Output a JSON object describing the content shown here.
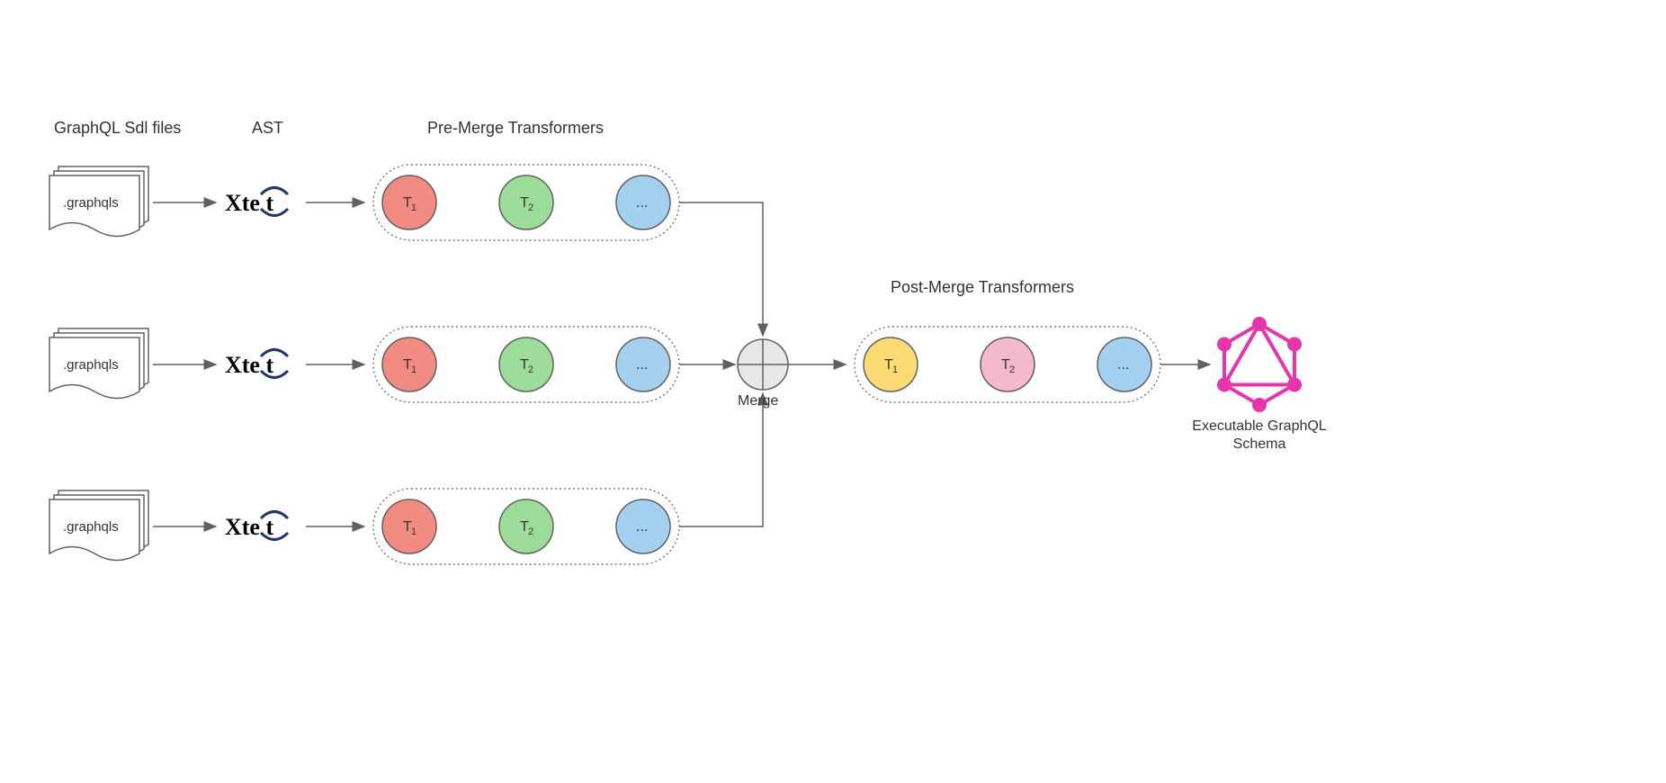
{
  "headers": {
    "sdl": "GraphQL Sdl files",
    "ast": "AST",
    "pre": "Pre-Merge Transformers",
    "post": "Post-Merge Transformers"
  },
  "file_label": ".graphqls",
  "xtext": "Xte  t",
  "transformers": {
    "t1": "T",
    "t1_sub": "1",
    "t2": "T",
    "t2_sub": "2",
    "t3": "..."
  },
  "merge_label": "Merge",
  "output_label_1": "Executable GraphQL",
  "output_label_2": "Schema",
  "colors": {
    "red": "#f28b82",
    "green": "#9edc9a",
    "blue": "#a3d1ef",
    "yellow": "#fddb74",
    "pink": "#f4b8cf",
    "grey": "#e8e8e8",
    "stroke": "#616161",
    "graphql": "#e535ab"
  }
}
